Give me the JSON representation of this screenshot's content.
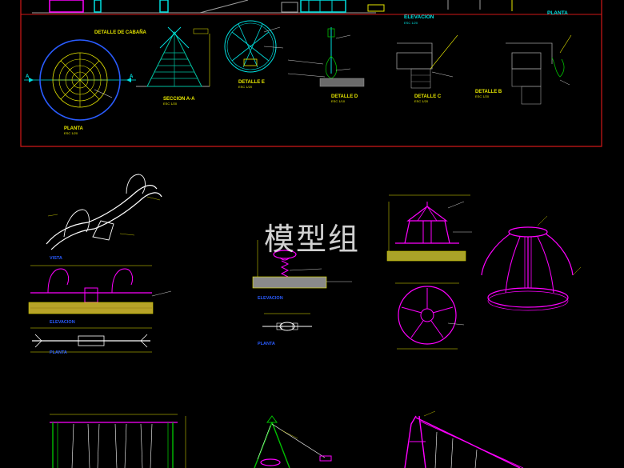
{
  "top_sheet": {
    "elevacion_title": "ELEVACION",
    "elevacion_scale": "ESC 1/20",
    "planta_top_title": "PLANTA",
    "detalle_cabana": "DETALLE DE CABAÑA",
    "seccion_aa": "SECCION A-A",
    "seccion_aa_scale": "ESC 1/20",
    "planta_title": "PLANTA",
    "planta_scale": "ESC 1/20",
    "detalle_e": "DETALLE E",
    "detalle_e_scale": "ESC 1/20",
    "detalle_d": "DETALLE D",
    "detalle_d_scale": "ESC 1/10",
    "detalle_c": "DETALLE C",
    "detalle_c_scale": "ESC 1/20",
    "detalle_b": "DETALLE B",
    "detalle_b_scale": "ESC 1/20",
    "axis_a_left": "A",
    "axis_a_right": "A"
  },
  "seesaw": {
    "vista_label": "VISTA",
    "elevacion_label": "ELEVACION",
    "planta_label": "PLANTA"
  },
  "spring_rider": {
    "elevacion_label": "ELEVACION",
    "planta_label": "PLANTA"
  },
  "watermark": "模型组",
  "colors": {
    "frame": "#d01818",
    "cyan": "#00e0e0",
    "yellow": "#e8e800",
    "white": "#ffffff",
    "magenta": "#ff00ff",
    "blue": "#2a5cff",
    "green": "#00c000",
    "gray": "#a0a0a0"
  }
}
